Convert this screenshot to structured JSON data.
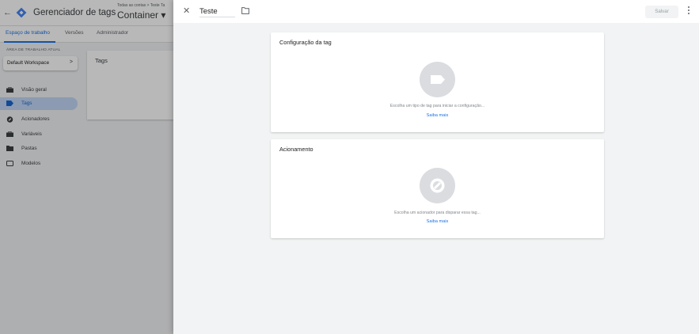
{
  "header": {
    "product_name": "Gerenciador de tags",
    "breadcrumb_small": "Todas as contas > Teste Ta",
    "container_name": "Container ▾"
  },
  "nav_tabs": [
    {
      "label": "Espaço de trabalho",
      "active": true
    },
    {
      "label": "Versões",
      "active": false
    },
    {
      "label": "Administrador",
      "active": false
    }
  ],
  "workspace": {
    "label": "ÁREA DE TRABALHO ATUAL",
    "name": "Default Workspace"
  },
  "sidebar": {
    "items": [
      {
        "label": "Visão geral",
        "icon": "briefcase-icon",
        "active": false
      },
      {
        "label": "Tags",
        "icon": "tag-icon",
        "active": true
      },
      {
        "label": "Acionadores",
        "icon": "trigger-icon",
        "active": false
      },
      {
        "label": "Variáveis",
        "icon": "briefcase-icon",
        "active": false
      },
      {
        "label": "Pastas",
        "icon": "folder-icon",
        "active": false
      },
      {
        "label": "Modelos",
        "icon": "template-icon",
        "active": false
      }
    ]
  },
  "tags_card": {
    "title": "Tags"
  },
  "editor": {
    "tag_name": "Teste",
    "save_label": "Salvar",
    "config_card": {
      "title": "Configuração da tag",
      "description": "Escolha um tipo de tag para iniciar a configuração...",
      "link": "Saiba mais"
    },
    "trigger_card": {
      "title": "Acionamento",
      "description": "Escolha um acionador para disparar essa tag...",
      "link": "Saiba mais"
    }
  },
  "colors": {
    "accent": "#1a73e8",
    "active_bg": "#c2d7f6",
    "panel_bg": "#f1f3f4",
    "icon_circle": "#dadce0"
  }
}
